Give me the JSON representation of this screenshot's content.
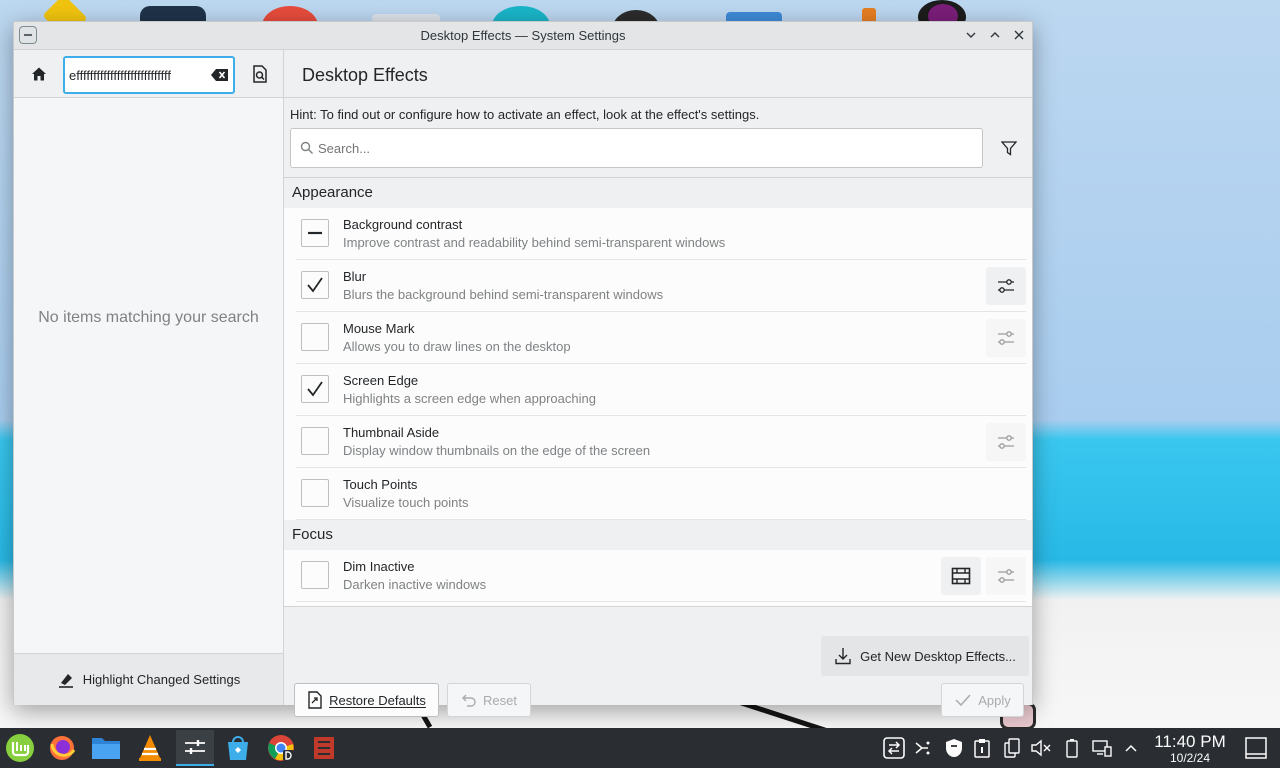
{
  "window": {
    "title": "Desktop Effects — System Settings"
  },
  "sidebar": {
    "search_value": "effffffffffffffffffffffffffff",
    "no_items_text": "No items matching your search",
    "highlight_label": "Highlight Changed Settings"
  },
  "main": {
    "title": "Desktop Effects",
    "hint": "Hint: To find out or configure how to activate an effect, look at the effect's settings.",
    "search_placeholder": "Search...",
    "sections": [
      {
        "title": "Appearance",
        "effects": [
          {
            "name": "Background contrast",
            "description": "Improve contrast and readability behind semi-transparent windows",
            "state": "partial"
          },
          {
            "name": "Blur",
            "description": "Blurs the background behind semi-transparent windows",
            "state": "checked"
          },
          {
            "name": "Mouse Mark",
            "description": "Allows you to draw lines on the desktop",
            "state": "unchecked"
          },
          {
            "name": "Screen Edge",
            "description": "Highlights a screen edge when approaching",
            "state": "checked"
          },
          {
            "name": "Thumbnail Aside",
            "description": "Display window thumbnails on the edge of the screen",
            "state": "unchecked"
          },
          {
            "name": "Touch Points",
            "description": "Visualize touch points",
            "state": "unchecked"
          }
        ]
      },
      {
        "title": "Focus",
        "effects": [
          {
            "name": "Dim Inactive",
            "description": "Darken inactive windows",
            "state": "unchecked"
          }
        ]
      }
    ],
    "get_new_label": "Get New Desktop Effects...",
    "restore_defaults_label": "Restore Defaults",
    "reset_label": "Reset",
    "apply_label": "Apply"
  },
  "taskbar": {
    "time": "11:40 PM",
    "date": "10/2/24"
  },
  "colors": {
    "accent": "#3daee9",
    "taskbar": "#2a2e32",
    "window_bg": "#eff0f1"
  }
}
